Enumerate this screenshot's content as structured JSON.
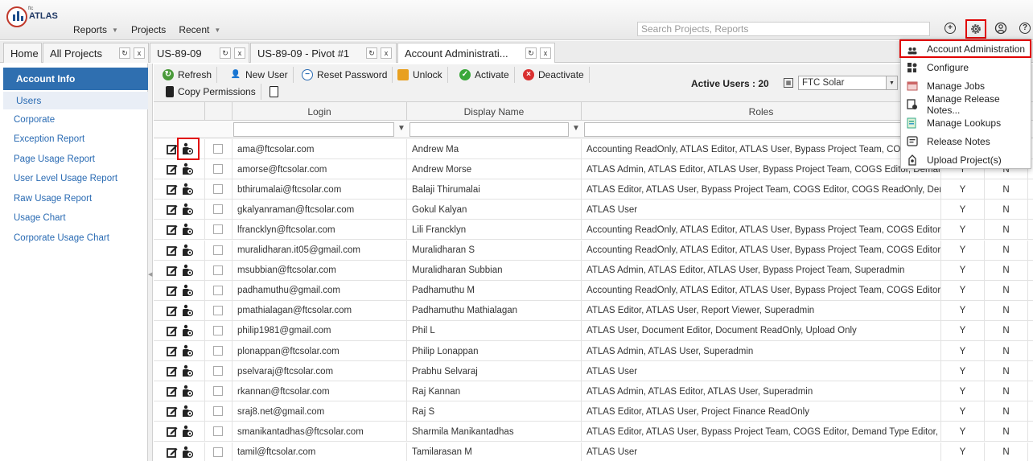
{
  "app": {
    "logo_small": "ftc",
    "logo_text": "ATLAS"
  },
  "menu": {
    "items": [
      {
        "label": "Reports",
        "has_caret": true
      },
      {
        "label": "Projects",
        "has_caret": false
      },
      {
        "label": "Recent",
        "has_caret": true
      }
    ]
  },
  "search": {
    "placeholder": "Search Projects, Reports"
  },
  "header_icons": [
    "plus-circle-icon",
    "gear-icon",
    "user-circle-icon",
    "help-icon"
  ],
  "tabs": [
    {
      "label": "Home",
      "closable": false,
      "active": false
    },
    {
      "label": "All Projects",
      "closable": true,
      "active": false
    },
    {
      "label": "US-89-09",
      "closable": true,
      "active": false
    },
    {
      "label": "US-89-09 - Pivot #1",
      "closable": true,
      "active": false
    },
    {
      "label": "Account Administrati...",
      "closable": true,
      "active": true
    }
  ],
  "tab_buttons": {
    "refresh": "↻",
    "close": "x"
  },
  "sidebar": {
    "header": "Account Info",
    "selected": "Users",
    "links": [
      "Corporate",
      "Exception Report",
      "Page Usage Report",
      "User Level Usage Report",
      "Raw Usage Report",
      "Usage Chart",
      "Corporate Usage Chart"
    ]
  },
  "toolbar": {
    "buttons_row1": [
      {
        "label": "Refresh",
        "icon": "refresh-icon",
        "color": "#4a9a3a"
      },
      {
        "label": "New User",
        "icon": "new-user-icon",
        "color": "#222222"
      },
      {
        "label": "Reset Password",
        "icon": "reset-password-icon",
        "color": "#2a6bb3"
      },
      {
        "label": "Unlock",
        "icon": "unlock-icon",
        "color": "#e8a020"
      },
      {
        "label": "Activate",
        "icon": "activate-icon",
        "color": "#3aa83a"
      },
      {
        "label": "Deactivate",
        "icon": "deactivate-icon",
        "color": "#d93030"
      }
    ],
    "buttons_row2": [
      {
        "label": "Copy Permissions",
        "icon": "copy-permissions-icon",
        "color": "#222222"
      },
      {
        "label": "",
        "icon": "document-icon",
        "color": "#222222"
      }
    ],
    "active_users_label": "Active Users : 20",
    "company_select": "FTC Solar"
  },
  "grid": {
    "columns": [
      "Login",
      "Display Name",
      "Roles"
    ],
    "rows": [
      {
        "login": "ama@ftcsolar.com",
        "name": "Andrew Ma",
        "roles": "Accounting ReadOnly, ATLAS Editor, ATLAS User, Bypass Project Team, COGS Editor, CO",
        "y": "Y",
        "n": "N"
      },
      {
        "login": "amorse@ftcsolar.com",
        "name": "Andrew Morse",
        "roles": "ATLAS Admin, ATLAS Editor, ATLAS User, Bypass Project Team, COGS Editor, Demand Ty",
        "y": "Y",
        "n": "N"
      },
      {
        "login": "bthirumalai@ftcsolar.com",
        "name": "Balaji Thirumalai",
        "roles": "ATLAS Editor, ATLAS User, Bypass Project Team, COGS Editor, COGS ReadOnly, Demand",
        "y": "Y",
        "n": "N"
      },
      {
        "login": "gkalyanraman@ftcsolar.com",
        "name": "Gokul Kalyan",
        "roles": "ATLAS User",
        "y": "Y",
        "n": "N"
      },
      {
        "login": "lfrancklyn@ftcsolar.com",
        "name": "Lili Francklyn",
        "roles": "Accounting ReadOnly, ATLAS Editor, ATLAS User, Bypass Project Team, COGS Editor, CO",
        "y": "Y",
        "n": "N"
      },
      {
        "login": "muralidharan.it05@gmail.com",
        "name": "Muralidharan S",
        "roles": "Accounting ReadOnly, ATLAS Editor, ATLAS User, Bypass Project Team, COGS Editor, CO",
        "y": "Y",
        "n": "N"
      },
      {
        "login": "msubbian@ftcsolar.com",
        "name": "Muralidharan Subbian",
        "roles": "ATLAS Admin, ATLAS Editor, ATLAS User, Bypass Project Team, Superadmin",
        "y": "Y",
        "n": "N"
      },
      {
        "login": "padhamuthu@gmail.com",
        "name": "Padhamuthu M",
        "roles": "Accounting ReadOnly, ATLAS Editor, ATLAS User, Bypass Project Team, COGS Editor, CO",
        "y": "Y",
        "n": "N"
      },
      {
        "login": "pmathialagan@ftcsolar.com",
        "name": "Padhamuthu Mathialagan",
        "roles": "ATLAS Editor, ATLAS User, Report Viewer, Superadmin",
        "y": "Y",
        "n": "N"
      },
      {
        "login": "philip1981@gmail.com",
        "name": "Phil L",
        "roles": "ATLAS User, Document Editor, Document ReadOnly, Upload Only",
        "y": "Y",
        "n": "N"
      },
      {
        "login": "plonappan@ftcsolar.com",
        "name": "Philip Lonappan",
        "roles": "ATLAS Admin, ATLAS User, Superadmin",
        "y": "Y",
        "n": "N"
      },
      {
        "login": "pselvaraj@ftcsolar.com",
        "name": "Prabhu Selvaraj",
        "roles": "ATLAS User",
        "y": "Y",
        "n": "N"
      },
      {
        "login": "rkannan@ftcsolar.com",
        "name": "Raj Kannan",
        "roles": "ATLAS Admin, ATLAS Editor, ATLAS User, Superadmin",
        "y": "Y",
        "n": "N"
      },
      {
        "login": "sraj8.net@gmail.com",
        "name": "Raj S",
        "roles": "ATLAS Editor, ATLAS User, Project Finance ReadOnly",
        "y": "Y",
        "n": "N"
      },
      {
        "login": "smanikantadhas@ftcsolar.com",
        "name": "Sharmila Manikantadhas",
        "roles": "ATLAS Editor, ATLAS User, Bypass Project Team, COGS Editor, Demand Type Editor, Doc",
        "y": "Y",
        "n": "N"
      },
      {
        "login": "tamil@ftcsolar.com",
        "name": "Tamilarasan M",
        "roles": "ATLAS User",
        "y": "Y",
        "n": "N"
      }
    ]
  },
  "settings_menu": {
    "items": [
      {
        "label": "Account Administration",
        "icon": "account-administration-icon",
        "highlighted": true
      },
      {
        "label": "Configure",
        "icon": "configure-icon",
        "highlighted": false
      },
      {
        "label": "Manage Jobs",
        "icon": "manage-jobs-icon",
        "highlighted": false
      },
      {
        "label": "Manage Release Notes...",
        "icon": "manage-release-notes-icon",
        "highlighted": false
      },
      {
        "label": "Manage Lookups",
        "icon": "manage-lookups-icon",
        "highlighted": false
      },
      {
        "label": "Release Notes",
        "icon": "release-notes-icon",
        "highlighted": false
      },
      {
        "label": "Upload Project(s)",
        "icon": "upload-projects-icon",
        "highlighted": false
      }
    ]
  },
  "colors": {
    "accent": "#2f6fb0",
    "link": "#2a6bb3",
    "highlight": "#e00000"
  }
}
